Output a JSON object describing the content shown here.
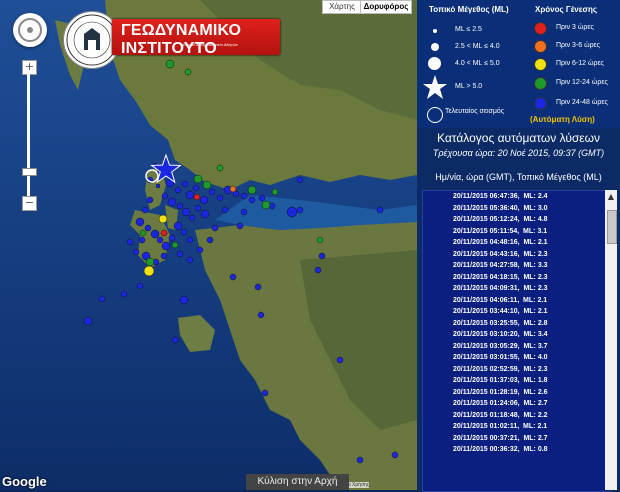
{
  "map": {
    "type_buttons": [
      "Χάρτης",
      "Δορυφόρος"
    ],
    "logo_title": "ΓΕΩΔΥΝΑΜΙΚΟ ΙΝΣΤΙΤΟΥΤΟ",
    "logo_subtitle": "Εθνικό Αστεροσκοπείο Αθηνών",
    "scroll_top": "Κύλιση στην Αρχή",
    "google_logo": "Google",
    "terms": "Όροι Χρήσης"
  },
  "legend": {
    "size_title": "Τοπικό Μέγεθος (ML)",
    "time_title": "Χρόνος Γένεσης",
    "size_classes": [
      "ML ≤ 2.5",
      "2.5 < ML ≤ 4.0",
      "4.0 < ML ≤ 5.0",
      "ML > 5.0",
      "Τελευταίος σεισμός"
    ],
    "age_classes": [
      {
        "label": "Πριν 3 ώρες",
        "color": "#e02020"
      },
      {
        "label": "Πριν 3-6 ώρες",
        "color": "#f07020"
      },
      {
        "label": "Πριν 6-12 ώρες",
        "color": "#f0e010"
      },
      {
        "label": "Πριν 12-24 ώρες",
        "color": "#1e9a2a"
      },
      {
        "label": "Πριν 24-48 ώρες",
        "color": "#1a26e0"
      }
    ],
    "auto_solution": "(Αυτόματη Λύση)"
  },
  "catalog": {
    "title": "Κατάλογος αυτόματων λύσεων",
    "current_time": "Τρέχουσα ώρα: 20 Νοέ 2015, 09:37 (GMT)",
    "header": "Ημ/νία, ώρα (GMT), Τοπικό Μέγεθος (ML)",
    "rows": [
      "20/11/2015 06:47:36,  ML: 2.4",
      "20/11/2015 05:36:40,  ML: 3.0",
      "20/11/2015 05:12:24,  ML: 4.8",
      "20/11/2015 05:11:54,  ML: 3.1",
      "20/11/2015 04:48:16,  ML: 2.1",
      "20/11/2015 04:43:16,  ML: 2.3",
      "20/11/2015 04:27:58,  ML: 3.3",
      "20/11/2015 04:18:15,  ML: 2.3",
      "20/11/2015 04:09:31,  ML: 2.3",
      "20/11/2015 04:06:11,  ML: 2.1",
      "20/11/2015 03:44:10,  ML: 2.1",
      "20/11/2015 03:25:55,  ML: 2.8",
      "20/11/2015 03:10:20,  ML: 3.4",
      "20/11/2015 03:05:29,  ML: 3.7",
      "20/11/2015 03:01:55,  ML: 4.0",
      "20/11/2015 02:52:59,  ML: 2.3",
      "20/11/2015 01:37:03,  ML: 1.8",
      "20/11/2015 01:28:19,  ML: 2.6",
      "20/11/2015 01:24:06,  ML: 2.7",
      "20/11/2015 01:18:48,  ML: 2.2",
      "20/11/2015 01:02:11,  ML: 2.1",
      "20/11/2015 00:37:21,  ML: 2.7",
      "20/11/2015 00:36:32,  ML: 0.8"
    ]
  },
  "icons": {
    "pegman": "pegman-icon",
    "zoom_in": "zoom-in-icon",
    "zoom_out": "zoom-out-icon",
    "star": "star-icon",
    "scroll_up": "scroll-up-icon"
  }
}
